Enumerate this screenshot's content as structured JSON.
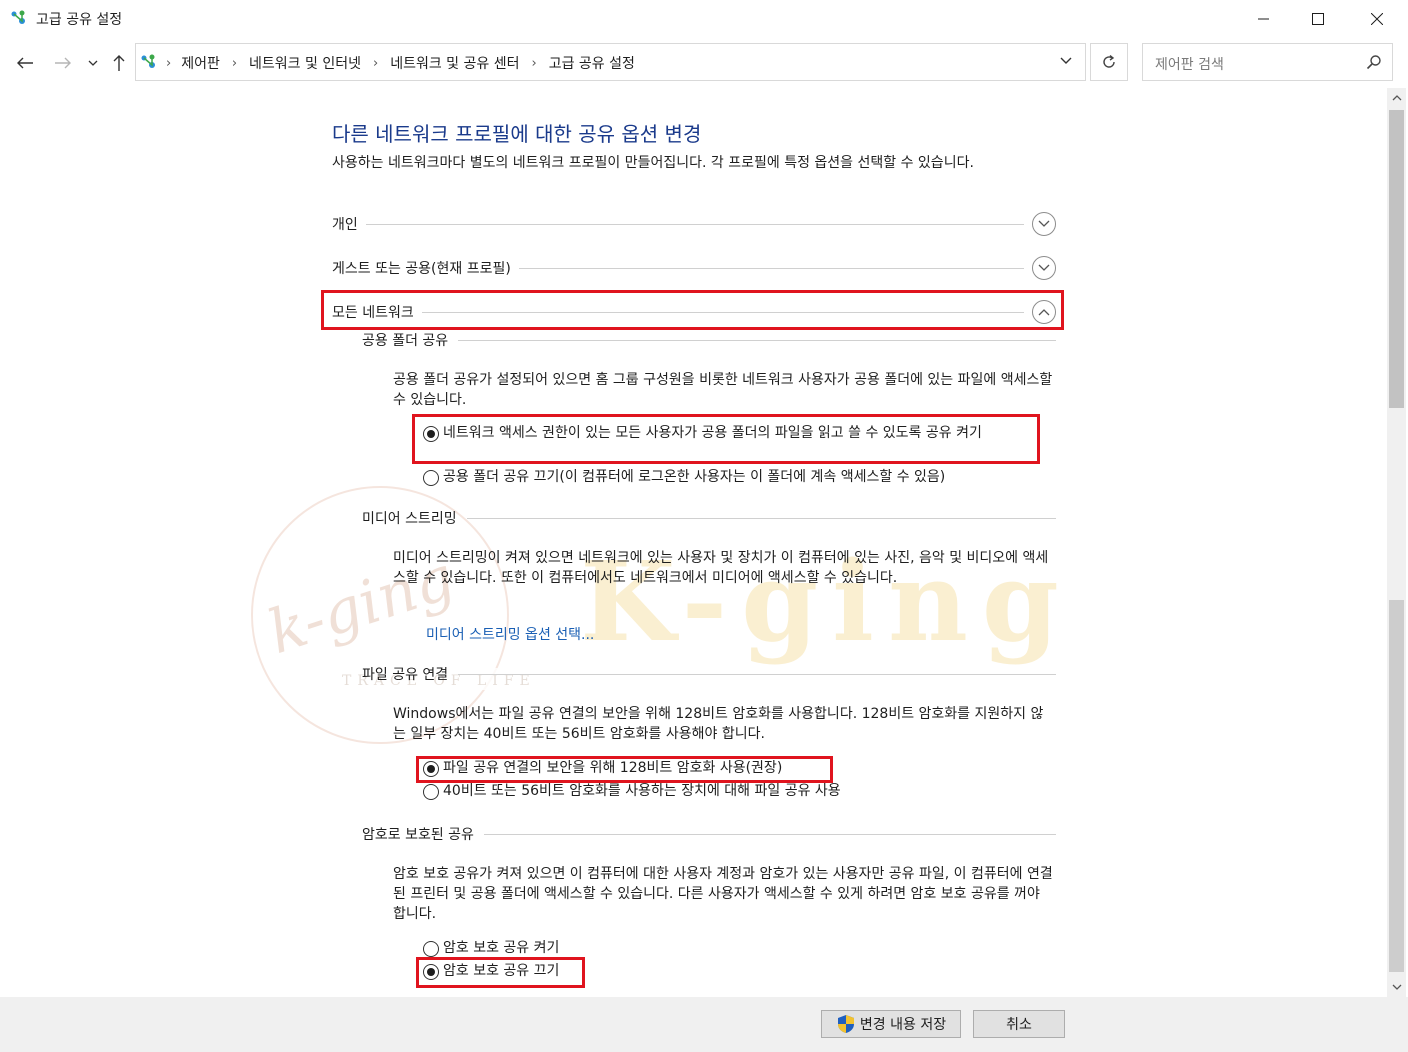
{
  "window": {
    "title": "고급 공유 설정"
  },
  "address": {
    "breadcrumbs": [
      "제어판",
      "네트워크 및 인터넷",
      "네트워크 및 공유 센터",
      "고급 공유 설정"
    ]
  },
  "search": {
    "placeholder": "제어판 검색"
  },
  "main": {
    "title": "다른 네트워크 프로필에 대한 공유 옵션 변경",
    "description": "사용하는 네트워크마다 별도의 네트워크 프로필이 만들어집니다. 각 프로필에 특정 옵션을 선택할 수 있습니다.",
    "profiles": [
      {
        "label": "개인",
        "expanded": false
      },
      {
        "label": "게스트 또는 공용(현재 프로필)",
        "expanded": false
      },
      {
        "label": "모든 네트워크",
        "expanded": true
      }
    ],
    "sections": {
      "public_folder": {
        "heading": "공용 폴더 공유",
        "text": "공용 폴더 공유가 설정되어 있으면 홈 그룹 구성원을 비롯한 네트워크 사용자가 공용 폴더에 있는 파일에 액세스할 수 있습니다.",
        "options": [
          {
            "label": "네트워크 액세스 권한이 있는 모든 사용자가 공용 폴더의 파일을 읽고 쓸 수 있도록 공유 켜기",
            "selected": true
          },
          {
            "label": "공용 폴더 공유 끄기(이 컴퓨터에 로그온한 사용자는 이 폴더에 계속 액세스할 수 있음)",
            "selected": false
          }
        ]
      },
      "media_streaming": {
        "heading": "미디어 스트리밍",
        "text": "미디어 스트리밍이 켜져 있으면 네트워크에 있는 사용자 및 장치가 이 컴퓨터에 있는 사진, 음악 및 비디오에 액세스할 수 있습니다. 또한 이 컴퓨터에서도 네트워크에서 미디어에 액세스할 수 있습니다.",
        "link": "미디어 스트리밍 옵션 선택..."
      },
      "file_sharing": {
        "heading": "파일 공유 연결",
        "text": "Windows에서는 파일 공유 연결의 보안을 위해 128비트 암호화를 사용합니다. 128비트 암호화를 지원하지 않는 일부 장치는 40비트 또는 56비트 암호화를 사용해야 합니다.",
        "options": [
          {
            "label": "파일 공유 연결의 보안을 위해 128비트 암호화 사용(권장)",
            "selected": true
          },
          {
            "label": "40비트 또는 56비트 암호화를 사용하는 장치에 대해 파일 공유 사용",
            "selected": false
          }
        ]
      },
      "password_protected": {
        "heading": "암호로 보호된 공유",
        "text": "암호 보호 공유가 켜져 있으면 이 컴퓨터에 대한 사용자 계정과 암호가 있는 사용자만 공유 파일, 이 컴퓨터에 연결된 프린터 및 공용 폴더에 액세스할 수 있습니다. 다른 사용자가 액세스할 수 있게 하려면 암호 보호 공유를 꺼야 합니다.",
        "options": [
          {
            "label": "암호 보호 공유 켜기",
            "selected": false
          },
          {
            "label": "암호 보호 공유 끄기",
            "selected": true
          }
        ]
      }
    }
  },
  "watermark": {
    "logo_text": "K-ging",
    "script_text": "k-ging",
    "tagline": "TRACE OF LIFE",
    "color": "#e8c27a"
  },
  "footer": {
    "save_label": "변경 내용 저장",
    "cancel_label": "취소"
  },
  "colors": {
    "title_blue": "#1a3a8b",
    "link_blue": "#1a5fb4",
    "highlight_red": "#e0141e"
  }
}
